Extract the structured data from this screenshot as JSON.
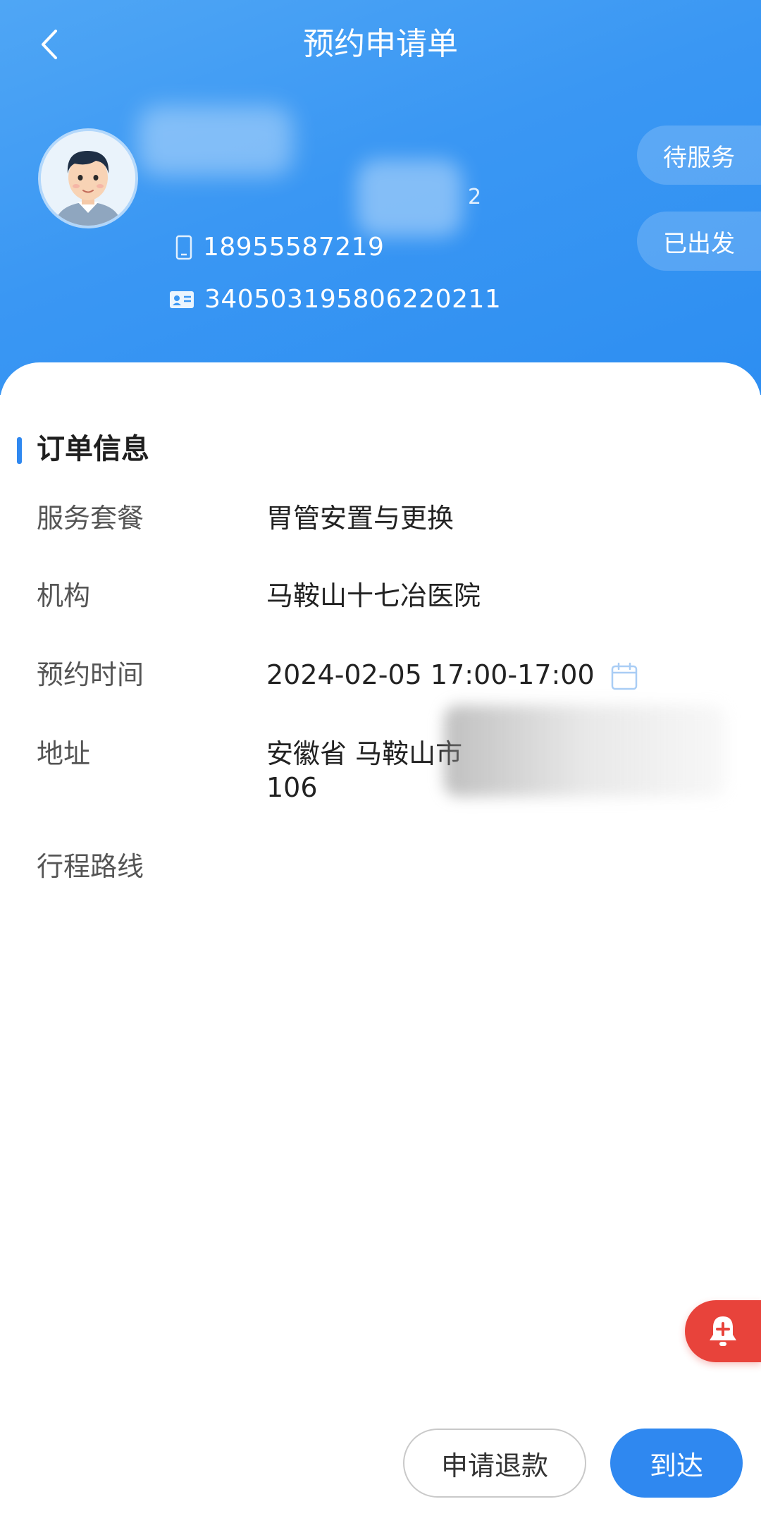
{
  "header": {
    "title": "预约申请单",
    "back_icon": "chevron-left-icon"
  },
  "profile": {
    "name_suffix": "2",
    "phone": "18955587219",
    "id_number": "340503195806220211"
  },
  "status_buttons": [
    {
      "label": "待服务"
    },
    {
      "label": "已出发"
    }
  ],
  "order_info": {
    "section_title": "订单信息",
    "rows": [
      {
        "label": "服务套餐",
        "value": "胃管安置与更换"
      },
      {
        "label": "机构",
        "value": "马鞍山十七冶医院"
      },
      {
        "label": "预约时间",
        "value": "2024-02-05 17:00-17:00"
      },
      {
        "label": "地址",
        "value": "安徽省 马鞍山市",
        "value_line2": "106"
      },
      {
        "label": "行程路线",
        "value": ""
      }
    ]
  },
  "actions": {
    "refund_label": "申请退款",
    "arrive_label": "到达"
  },
  "colors": {
    "header_blue": "#3a97f3",
    "accent": "#2f88f0",
    "alert_red": "#e8433b"
  }
}
